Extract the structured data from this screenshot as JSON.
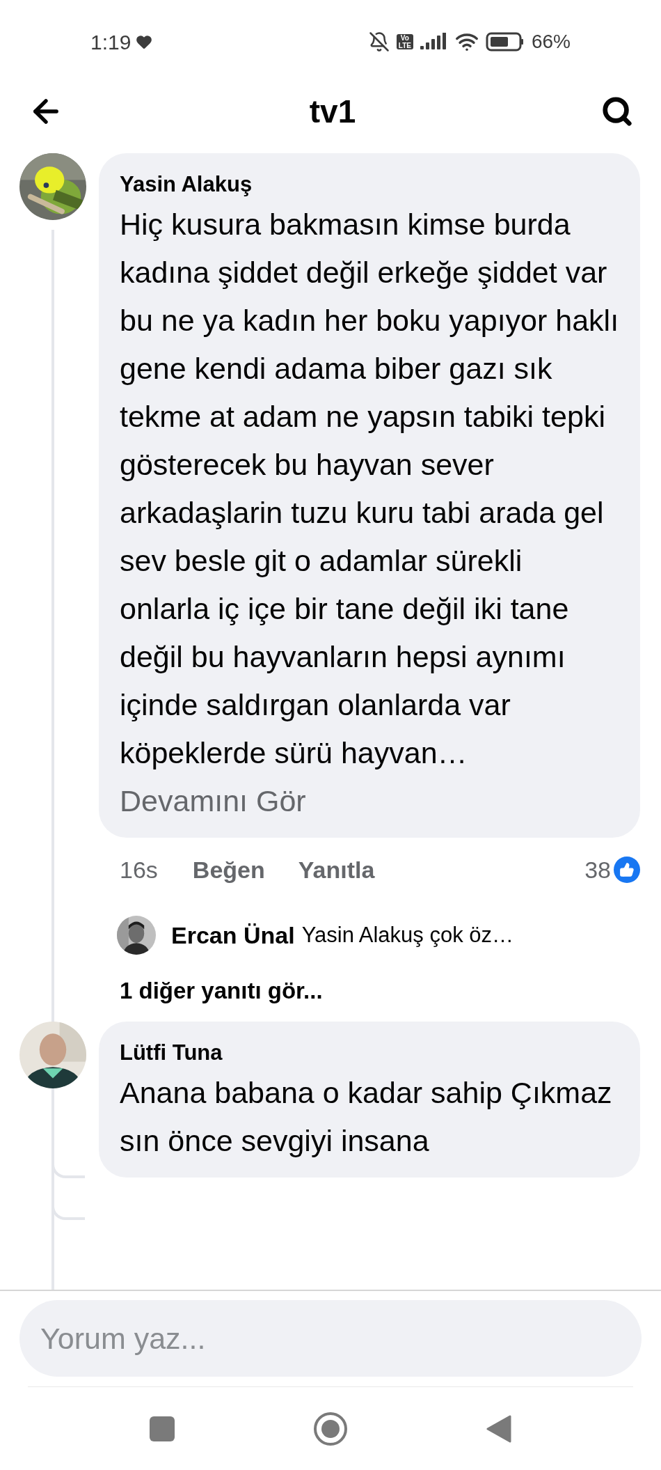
{
  "status_bar": {
    "time": "1:19",
    "volte": [
      "Vo",
      "LTE"
    ],
    "battery": "66%"
  },
  "header": {
    "title": "tv1"
  },
  "comments": [
    {
      "author": "Yasin Alakuş",
      "text": "Hiç kusura bakmasın kimse burda kadına şiddet değil erkeğe şiddet var bu ne ya kadın her boku yapıyor haklı gene kendi adama biber gazı sık tekme at adam ne yapsın tabiki tepki gösterecek bu hayvan sever arkadaşlarin tuzu kuru tabi arada gel sev besle git o adamlar sürekli onlarla iç içe bir tane değil iki tane değil bu hayvanların hepsi aynımı içinde saldırgan olanlarda var köpeklerde sürü hayvan…",
      "more_link": "Devamını Gör",
      "time": "16s",
      "actions": [
        "Beğen",
        "Yanıtla"
      ],
      "reaction_count": "38",
      "replies": [
        {
          "author": "Ercan Ünal",
          "text": "Yasin Alakuş çok öz…"
        }
      ],
      "more_replies": "1 diğer yanıtı gör..."
    },
    {
      "author": "Lütfi Tuna",
      "text": "Anana babana o kadar sahip Çıkmaz sın önce sevgiyi insana"
    }
  ],
  "composer": {
    "placeholder": "Yorum yaz..."
  }
}
